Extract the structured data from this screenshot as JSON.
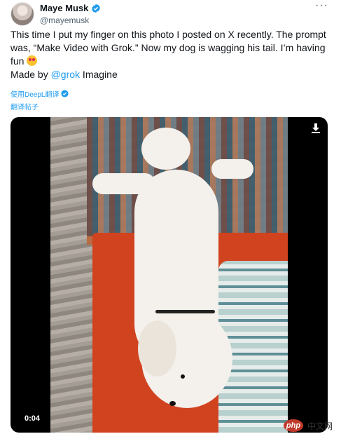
{
  "author": {
    "name": "Maye Musk",
    "handle": "@mayemusk"
  },
  "tweet": {
    "line1": "This time I put my finger on this photo I posted on X recently. The prompt was, “Make Video with Grok.” Now my dog is wagging his tail. I’m having fun",
    "made_by_prefix": "Made by ",
    "made_by_mention": "@grok",
    "made_by_suffix": " Imagine"
  },
  "translation": {
    "by_label": "使用DeepL翻译",
    "translate_post": "翻译帖子"
  },
  "video": {
    "timestamp": "0:04"
  },
  "watermark": {
    "php": "php",
    "cn": "中文网"
  },
  "colors": {
    "accent": "#1d9bf0",
    "text": "#0f1419",
    "muted": "#536471"
  },
  "icons": [
    "verified-icon",
    "more-icon",
    "download-icon",
    "deepl-check-icon"
  ]
}
